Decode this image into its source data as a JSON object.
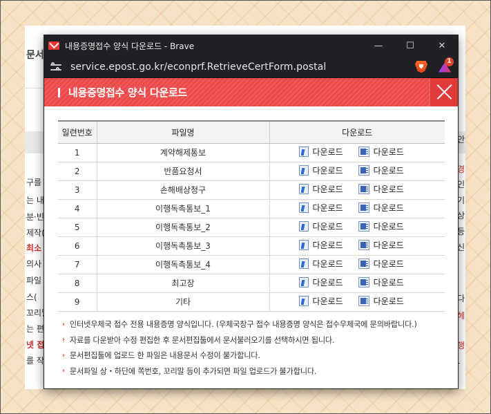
{
  "background_page": {
    "left_title": "문서를",
    "left_lines": [
      {
        "text": "구를 이",
        "red": false
      },
      {
        "text": "는 내용",
        "red": false
      },
      {
        "text": "분·빈",
        "red": false
      },
      {
        "text": "제작(",
        "red": false
      },
      {
        "text": "최소",
        "red": true
      },
      {
        "text": "의사",
        "red": false
      },
      {
        "text": "파일 :",
        "red": false
      },
      {
        "text": "스(",
        "red": false
      },
      {
        "text": "꼬리말",
        "red": false
      },
      {
        "text": "는 편집",
        "red": false
      },
      {
        "text": "넷 접수",
        "red": true
      },
      {
        "text": "를 작",
        "red": false
      }
    ],
    "right_lines": [
      {
        "text": "안",
        "red": false
      },
      {
        "text": "경",
        "red": true
      },
      {
        "text": "인",
        "red": false
      },
      {
        "text": "기",
        "red": false
      },
      {
        "text": "상",
        "red": false
      },
      {
        "text": "등",
        "red": false
      },
      {
        "text": "신",
        "red": false
      },
      {
        "text": "다",
        "red": false
      },
      {
        "text": "헤",
        "red": true
      },
      {
        "text": "행",
        "red": true
      },
      {
        "text": "-",
        "red": false
      }
    ]
  },
  "window": {
    "title": "내용증명접수 양식 다운로드 - Brave",
    "url": "service.epost.go.kr/econprf.RetrieveCertForm.postal",
    "rewards_badge": "1",
    "controls": {
      "minimize": "—",
      "maximize": "☐",
      "close": "✕"
    }
  },
  "header": {
    "title": "내용증명접수 양식 다운로드"
  },
  "table": {
    "columns": [
      "일련번호",
      "파일명",
      "다운로드"
    ],
    "download_label": "다운로드",
    "rows": [
      {
        "no": "1",
        "name": "계약해제통보"
      },
      {
        "no": "2",
        "name": "반품요청서"
      },
      {
        "no": "3",
        "name": "손해배상청구"
      },
      {
        "no": "4",
        "name": "이행독촉통보_1"
      },
      {
        "no": "5",
        "name": "이행독촉통보_2"
      },
      {
        "no": "6",
        "name": "이행독촉통보_3"
      },
      {
        "no": "7",
        "name": "이행독촉통보_4"
      },
      {
        "no": "8",
        "name": "최고장"
      },
      {
        "no": "9",
        "name": "기타"
      }
    ]
  },
  "notes": [
    "인터넷우체국 접수 전용 내용증명 양식입니다. (우체국창구 접수 내용증명 양식은 접수우체국에 문의바랍니다.)",
    "자료를 다운받아 수정 편집한 후 문서편집툴에서 문서불러오기를 선택하시면 됩니다.",
    "문서편집툴에 업로드 한 파일은 내용문서 수정이 불가합니다.",
    "문서파일 상・하단에 쪽번호, 꼬리말 등이 추가되면 파일 업로드가 불가합니다."
  ],
  "colors": {
    "header_red": "#ec4a4a",
    "titlebar_dark": "#202124",
    "note_chevron": "#e0442b"
  },
  "icons": [
    "mail-icon",
    "site-settings-icon",
    "brave-shield-icon",
    "brave-rewards-icon",
    "close-icon",
    "hwp-file-icon",
    "word-file-icon"
  ]
}
